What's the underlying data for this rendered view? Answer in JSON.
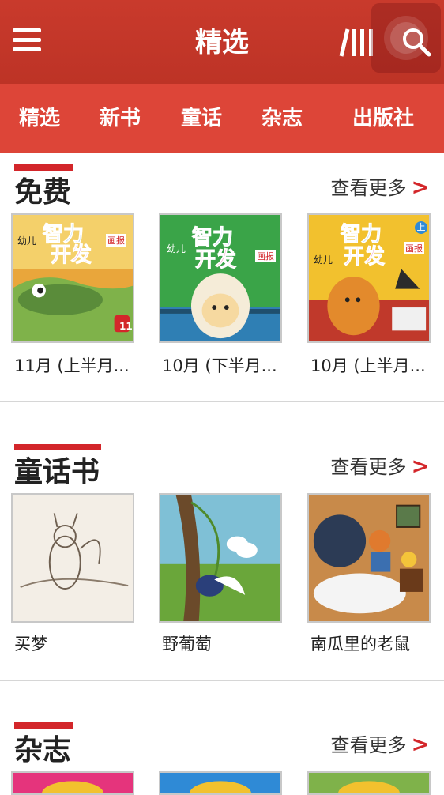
{
  "header": {
    "title": "精选",
    "menu_icon": "hamburger-menu-icon",
    "bars_icon": "library-bars-icon",
    "search_icon": "search-icon",
    "color": "#c0392b"
  },
  "tabs": [
    "精选",
    "新书",
    "童话",
    "杂志",
    "出版社"
  ],
  "tab_bar_color": "#dd4538",
  "sections": [
    {
      "title": "免费",
      "more": "查看更多",
      "items": [
        {
          "caption": "11月 (上半月...",
          "cover_text": [
            "智力",
            "开发",
            "幼儿",
            "画报",
            "11"
          ]
        },
        {
          "caption": "10月 (下半月...",
          "cover_text": [
            "智力",
            "开发",
            "幼儿",
            "画报"
          ]
        },
        {
          "caption": "10月 (上半月...",
          "cover_text": [
            "智力",
            "开发",
            "幼儿",
            "画报",
            "上"
          ]
        }
      ]
    },
    {
      "title": "童话书",
      "more": "查看更多",
      "items": [
        {
          "caption": "买梦"
        },
        {
          "caption": "野葡萄"
        },
        {
          "caption": "南瓜里的老鼠"
        }
      ]
    },
    {
      "title": "杂志",
      "more": "查看更多",
      "items": []
    }
  ],
  "accent_color": "#d3262a"
}
